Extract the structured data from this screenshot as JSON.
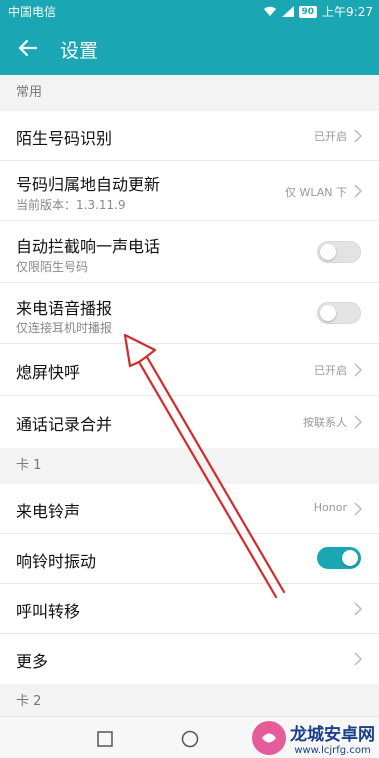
{
  "status_bar": {
    "carrier": "中国电信",
    "battery": "90",
    "time": "上午9:27"
  },
  "app_bar": {
    "title": "设置"
  },
  "sections": {
    "common": "常用",
    "card1": "卡 1",
    "card2": "卡 2"
  },
  "rows": {
    "stranger_id": {
      "label": "陌生号码识别",
      "value": "已开启"
    },
    "location_update": {
      "label": "号码归属地自动更新",
      "sub": "当前版本：1.3.11.9",
      "value": "仅 WLAN 下"
    },
    "block_one_ring": {
      "label": "自动拦截响一声电话",
      "sub": "仅限陌生号码",
      "toggle": false
    },
    "voice_announce": {
      "label": "来电语音播报",
      "sub": "仅连接耳机时播报",
      "toggle": false
    },
    "screen_off_call": {
      "label": "熄屏快呼",
      "value": "已开启"
    },
    "merge_records": {
      "label": "通话记录合并",
      "value": "按联系人"
    },
    "ringtone": {
      "label": "来电铃声",
      "value": "Honor"
    },
    "vibrate": {
      "label": "响铃时振动",
      "toggle": true
    },
    "forwarding": {
      "label": "呼叫转移"
    },
    "more": {
      "label": "更多"
    }
  },
  "watermark": {
    "title": "龙城安卓网",
    "url": "www.lcjrfg.com"
  },
  "colors": {
    "accent": "#1aa7b3",
    "arrow": "#d42a2a"
  }
}
